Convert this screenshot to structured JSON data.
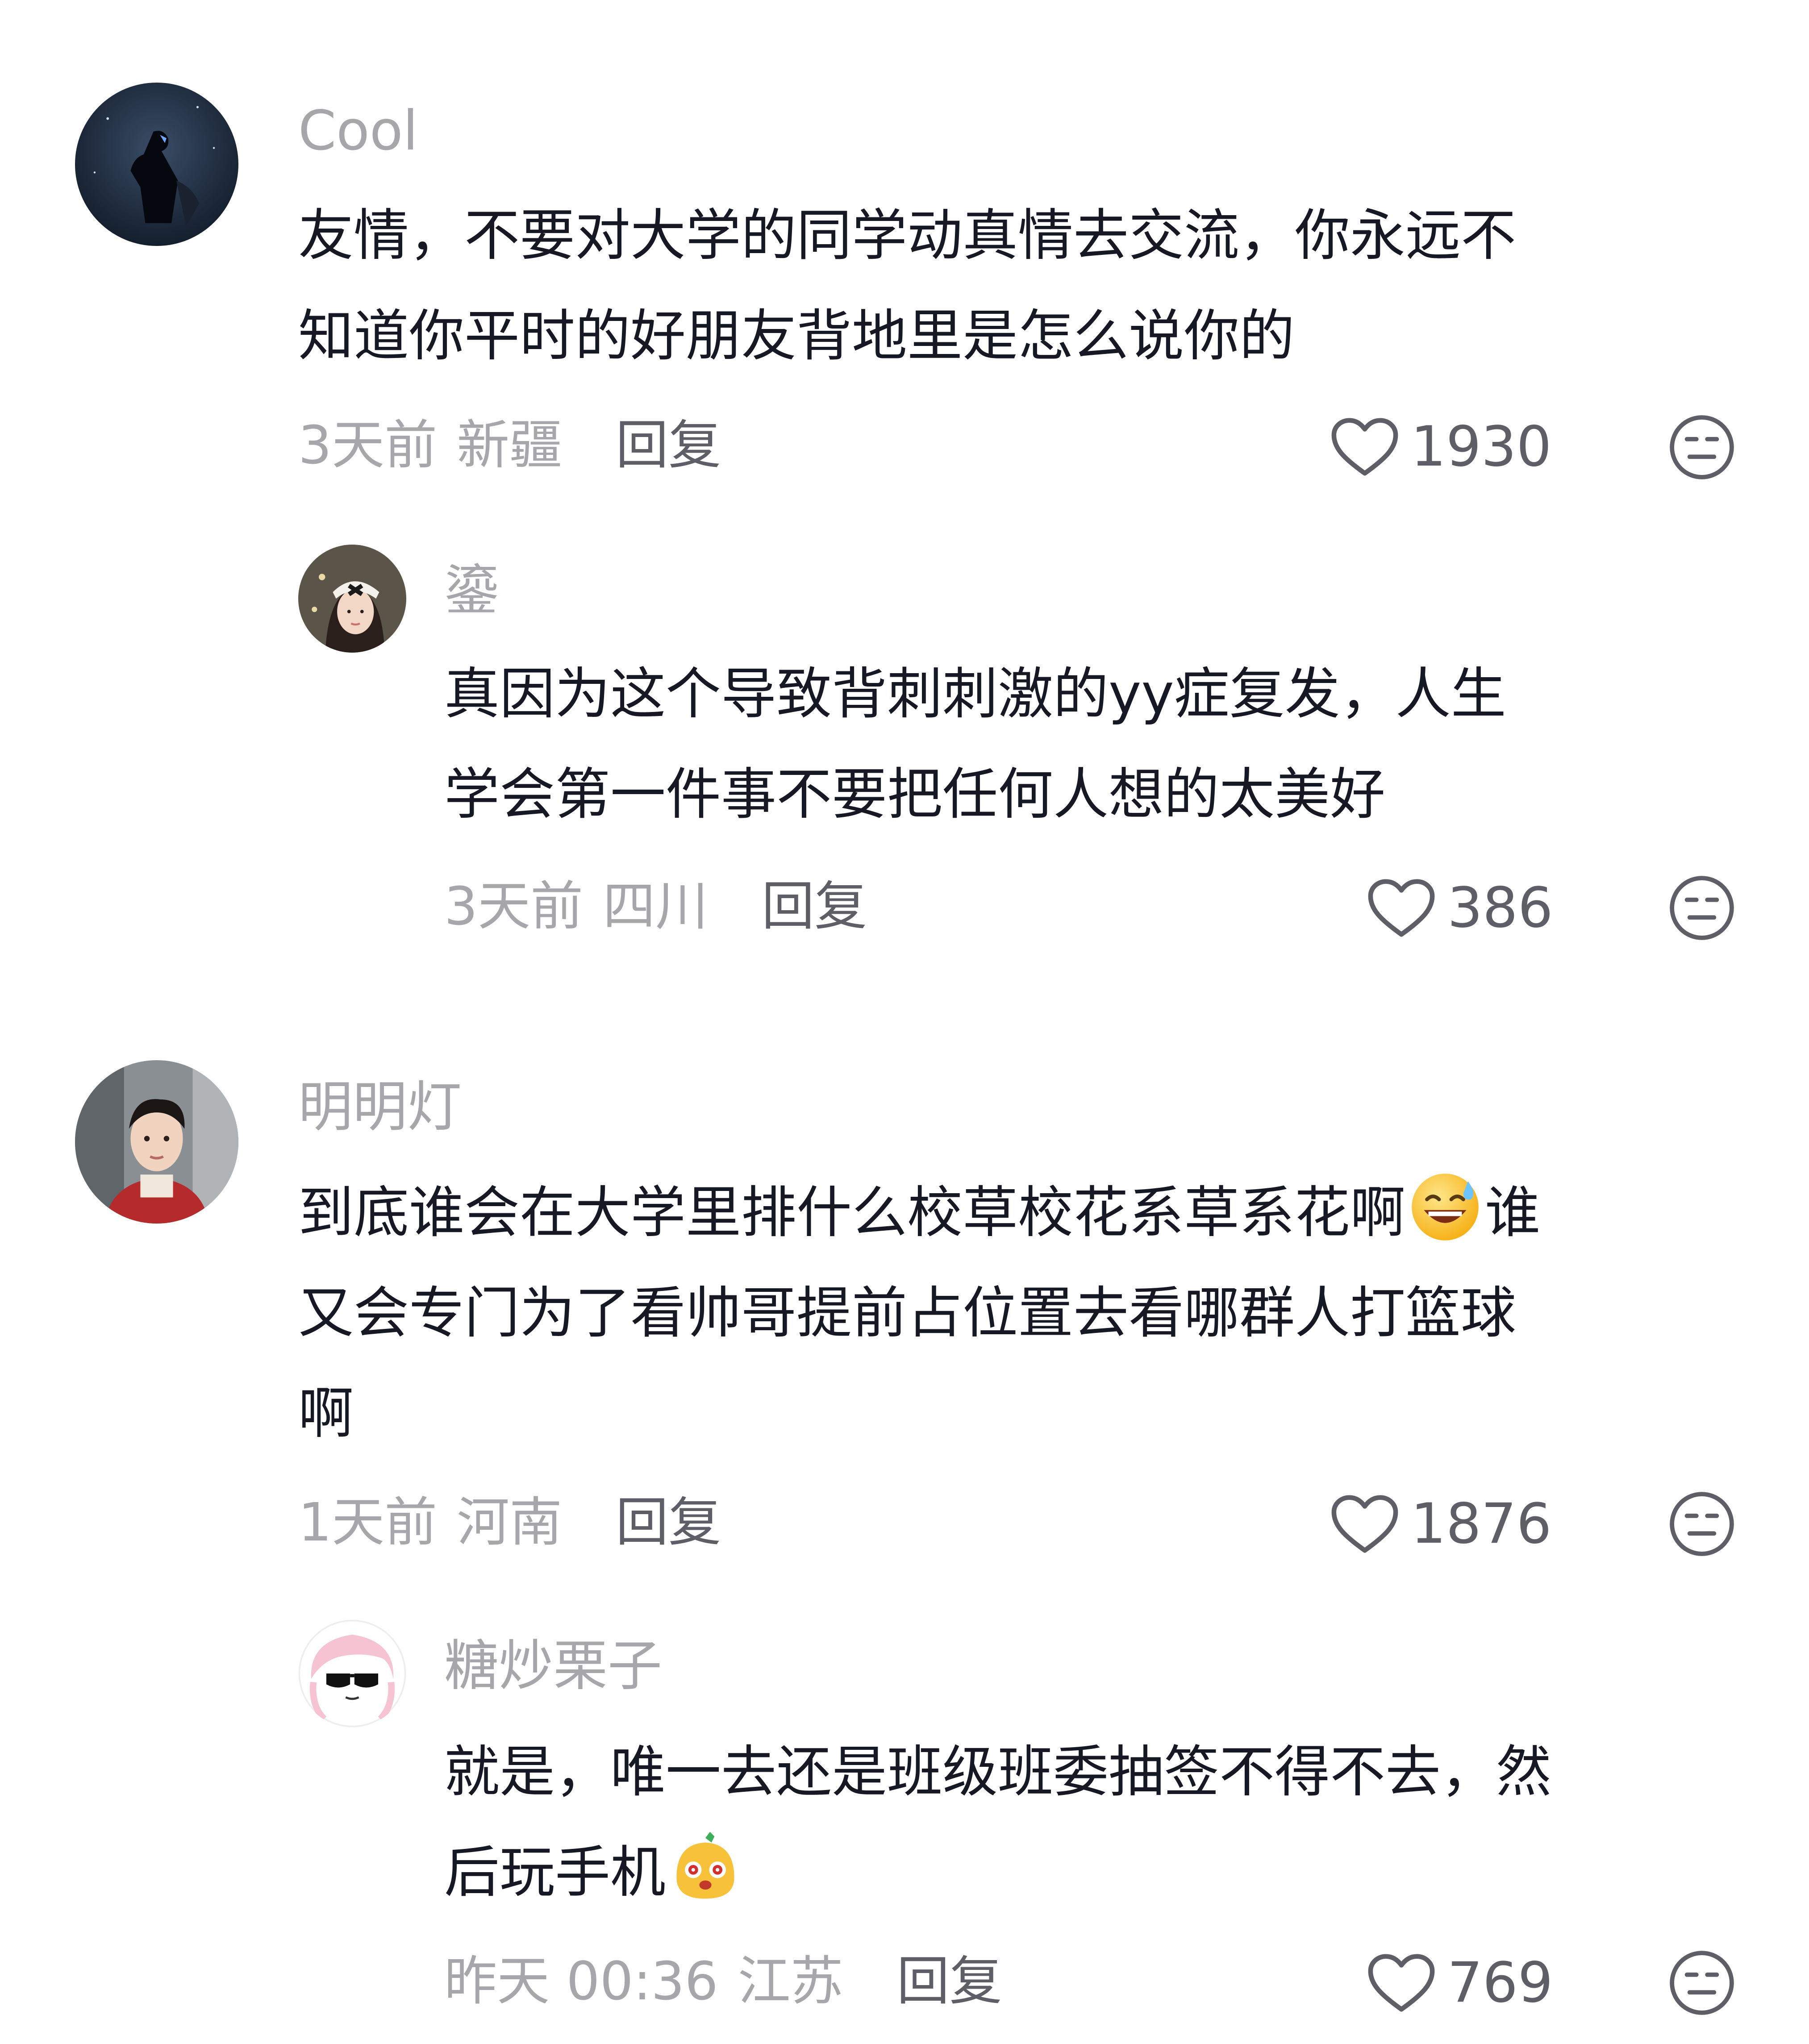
{
  "comments": [
    {
      "username": "Cool",
      "lines": [
        "友情，不要对大学的同学动真情去交流，你永远不",
        "知道你平时的好朋友背地里是怎么说你的"
      ],
      "time": "3天前",
      "region": "新疆",
      "reply_label": "回复",
      "likes": "1930",
      "avatar_icon": "night-figure-avatar",
      "replies": [
        {
          "username": "鎏",
          "lines": [
            "真因为这个导致背刺刺激的yy症复发，人生",
            "学会第一件事不要把任何人想的太美好"
          ],
          "time": "3天前",
          "region": "四川",
          "reply_label": "回复",
          "likes": "386",
          "avatar_icon": "girl-headband-avatar"
        }
      ]
    },
    {
      "username": "明明灯",
      "lines_before_emoji": "到底谁会在大学里排什么校草校花系草系花啊",
      "emoji_icon": "grinning-sweat-emoji",
      "line1_after_emoji": "谁",
      "line2": "又会专门为了看帅哥提前占位置去看哪群人打篮球",
      "line3": "啊",
      "time": "1天前",
      "region": "河南",
      "reply_label": "回复",
      "likes": "1876",
      "avatar_icon": "young-man-avatar",
      "replies": [
        {
          "username": "糖炒栗子",
          "line1": "就是，唯一去还是班级班委抽签不得不去，然",
          "line2_before_emoji": "后玩手机",
          "emoji_icon": "cartoon-blob-emoji",
          "time": "昨天 00:36",
          "region": "江苏",
          "reply_label": "回复",
          "likes": "769",
          "avatar_icon": "anime-sunglasses-avatar"
        }
      ]
    }
  ],
  "icons": {
    "like": "heart-icon",
    "dislike": "meh-face-icon"
  },
  "colors": {
    "username": "#a7a7ab",
    "text": "#161823",
    "meta": "#a7a7ab",
    "reply": "#5e5f66",
    "icon": "#5e5f66"
  }
}
